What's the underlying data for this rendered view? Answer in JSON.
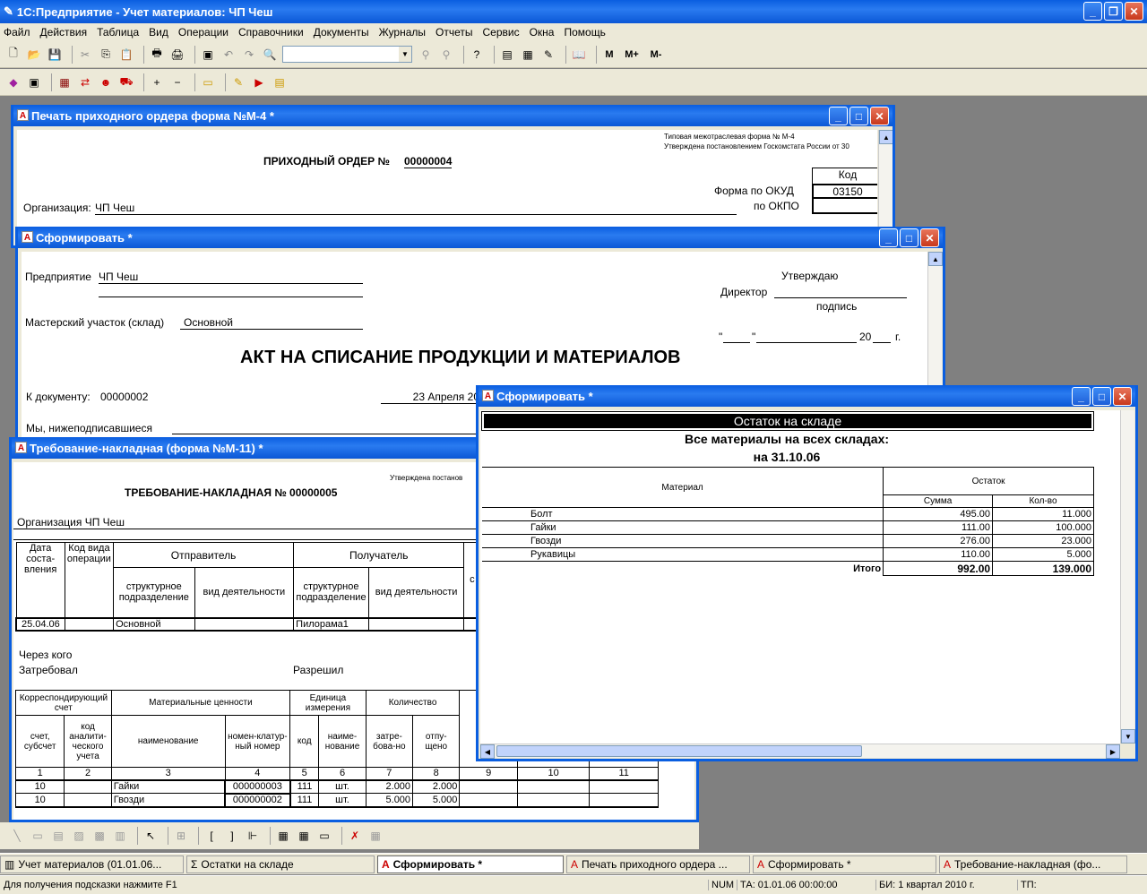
{
  "app": {
    "title": "1С:Предприятие - Учет материалов: ЧП Чеш"
  },
  "menu": [
    "Файл",
    "Действия",
    "Таблица",
    "Вид",
    "Операции",
    "Справочники",
    "Документы",
    "Журналы",
    "Отчеты",
    "Сервис",
    "Окна",
    "Помощь"
  ],
  "toolbar": {
    "m": "M",
    "mplus": "M+",
    "mminus": "M-"
  },
  "win_m4": {
    "title": "Печать приходного ордера форма №М-4  *",
    "header1": "Типовая межотраслевая форма № М-4",
    "header2": "Утверждена постановлением Госкомстата России от 30",
    "order_title": "ПРИХОДНЫЙ ОРДЕР №",
    "order_no": "00000004",
    "code_label": "Код",
    "okud_label": "Форма по ОКУД",
    "okud_value": "03150",
    "okpo_label": "по ОКПО",
    "org_label": "Организация:",
    "org_value": "ЧП Чеш"
  },
  "win_akt": {
    "title": "Сформировать  *",
    "enterprise_label": "Предприятие",
    "enterprise_value": "ЧП Чеш",
    "approve": "Утверждаю",
    "director": "Директор",
    "signature": "подпись",
    "shop_label": "Мастерский участок (склад)",
    "shop_value": "Основной",
    "date_q1": "\"",
    "date_q2": "\"",
    "year_prefix": "20",
    "year_suffix": "г.",
    "main_title": "АКТ НА СПИСАНИЕ ПРОДУКЦИИ И МАТЕРИАЛОВ",
    "doc_label": "К документу:",
    "doc_value": "00000002",
    "doc_date": "23 Апреля 20",
    "we_label": "Мы, нижеподписавшиеся"
  },
  "win_m11": {
    "title": "Требование-накладная (форма №М-11)  *",
    "header": "Утверждена постанов",
    "doc_title": "ТРЕБОВАНИЕ-НАКЛАДНАЯ № 00000005",
    "org": "Организация ЧП Чеш",
    "h_date": "Дата соста-вления",
    "h_opcode": "Код вида операции",
    "h_sender": "Отправитель",
    "h_receiver": "Получатель",
    "h_struct": "структурное подразделение",
    "h_activity": "вид деятельности",
    "h_struct2": "структурное подразделение",
    "h_activity2": "вид деятельности",
    "h_cut1": "с",
    "h_cut2": "су",
    "row_date": "25.04.06",
    "row_sender": "Основной",
    "row_receiver": "Пилорама1",
    "via": "Через кого",
    "requested": "Затребовал",
    "allowed": "Разрешил",
    "t2_corr": "Корреспондирующий счет",
    "t2_values": "Материальные ценности",
    "t2_unit": "Единица измерения",
    "t2_qty": "Количество",
    "t2_cut": "ру",
    "t2_acc": "счет, субсчет",
    "t2_anal": "код аналити-ческого учета",
    "t2_name": "наименование",
    "t2_nomen": "номен-клатур-ный номер",
    "t2_code": "код",
    "t2_uname": "наиме-нование",
    "t2_req": "затре-бова-но",
    "t2_rel": "отпу-щено",
    "t2_nums": [
      "1",
      "2",
      "3",
      "4",
      "5",
      "6",
      "7",
      "8",
      "9",
      "10",
      "11"
    ],
    "rows": [
      {
        "acc": "10",
        "name": "Гайки",
        "nomen": "000000003",
        "code": "111",
        "unit": "шт.",
        "req": "2.000",
        "rel": "2.000"
      },
      {
        "acc": "10",
        "name": "Гвозди",
        "nomen": "000000002",
        "code": "111",
        "unit": "шт.",
        "req": "5.000",
        "rel": "5.000"
      }
    ]
  },
  "win_stock": {
    "title": "Сформировать  *",
    "banner": "Остаток на складе",
    "sub1": "Все материалы на всех складах:",
    "sub2": "на 31.10.06",
    "h_material": "Материал",
    "h_rest": "Остаток",
    "h_sum": "Сумма",
    "h_qty": "Кол-во",
    "rows": [
      {
        "name": "Болт",
        "sum": "495.00",
        "qty": "11.000"
      },
      {
        "name": "Гайки",
        "sum": "111.00",
        "qty": "100.000"
      },
      {
        "name": "Гвозди",
        "sum": "276.00",
        "qty": "23.000"
      },
      {
        "name": "Рукавицы",
        "sum": "110.00",
        "qty": "5.000"
      }
    ],
    "total_label": "Итого",
    "total_sum": "992.00",
    "total_qty": "139.000"
  },
  "taskbar": [
    {
      "label": "Учет материалов   (01.01.06...",
      "active": false
    },
    {
      "label": "Остатки на складе",
      "active": false
    },
    {
      "label": "Сформировать  *",
      "active": true
    },
    {
      "label": "Печать приходного ордера ...",
      "active": false
    },
    {
      "label": "Сформировать  *",
      "active": false
    },
    {
      "label": "Требование-накладная (фо...",
      "active": false
    }
  ],
  "status": {
    "hint": "Для получения подсказки нажмите F1",
    "num": "NUM",
    "ta": "ТА: 01.01.06  00:00:00",
    "bi": "БИ: 1 квартал 2010 г.",
    "tp": "ТП:"
  }
}
